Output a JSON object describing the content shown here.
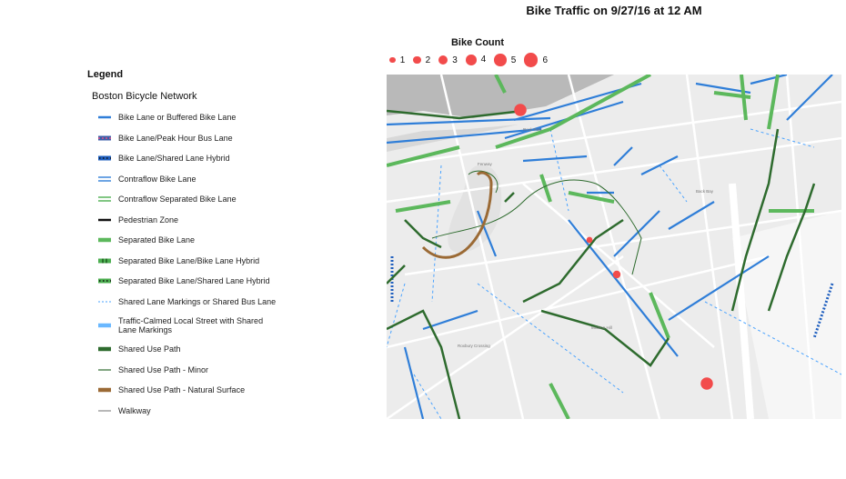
{
  "title": "Bike Traffic on 9/27/16 at 12 AM",
  "bike_count": {
    "title": "Bike Count",
    "color": "#f24b4b",
    "scale": [
      {
        "label": "1",
        "value": 1
      },
      {
        "label": "2",
        "value": 2
      },
      {
        "label": "3",
        "value": 3
      },
      {
        "label": "4",
        "value": 4
      },
      {
        "label": "5",
        "value": 5
      },
      {
        "label": "6",
        "value": 6
      }
    ]
  },
  "legend": {
    "title": "Legend",
    "subtitle": "Boston Bicycle Network",
    "items": [
      {
        "label": "Bike Lane or Buffered Bike Lane",
        "symbol": "solid",
        "color": "#2f7ed8"
      },
      {
        "label": "Bike Lane/Peak Hour Bus Lane",
        "symbol": "dashed-block",
        "color": "#3b5ea8"
      },
      {
        "label": "Bike Lane/Shared Lane Hybrid",
        "symbol": "dotted-block",
        "color": "#1f5fbf"
      },
      {
        "label": "Contraflow Bike Lane",
        "symbol": "double-line",
        "color": "#2f7ed8"
      },
      {
        "label": "Contraflow Separated Bike Lane",
        "symbol": "double-line",
        "color": "#4caf50"
      },
      {
        "label": "Pedestrian Zone",
        "symbol": "solid",
        "color": "#111111"
      },
      {
        "label": "Separated Bike Lane",
        "symbol": "thick",
        "color": "#5cb85c"
      },
      {
        "label": "Separated Bike Lane/Bike Lane Hybrid",
        "symbol": "striped-block",
        "color": "#4caf50"
      },
      {
        "label": "Separated Bike Lane/Shared Lane Hybrid",
        "symbol": "dotted-block",
        "color": "#4caf50"
      },
      {
        "label": "Shared Lane Markings or Shared Bus Lane",
        "symbol": "thin-dashed",
        "color": "#4aa3ff"
      },
      {
        "label": "Traffic-Calmed Local Street with Shared Lane Markings",
        "symbol": "thick",
        "color": "#6ab8ff"
      },
      {
        "label": "Shared Use Path",
        "symbol": "thick",
        "color": "#2e6b2e"
      },
      {
        "label": "Shared Use Path - Minor",
        "symbol": "thin",
        "color": "#2e6b2e"
      },
      {
        "label": "Shared Use Path - Natural Surface",
        "symbol": "thick",
        "color": "#9b6a35"
      },
      {
        "label": "Walkway",
        "symbol": "thin",
        "color": "#888888"
      }
    ]
  },
  "map": {
    "bike_counters": [
      {
        "count": 5
      },
      {
        "count": 1
      },
      {
        "count": 2
      },
      {
        "count": 5
      }
    ],
    "labels": [
      "Back Bay",
      "Rock Row",
      "Mission Hill",
      "Roxbury Crossing",
      "Fenway"
    ]
  }
}
